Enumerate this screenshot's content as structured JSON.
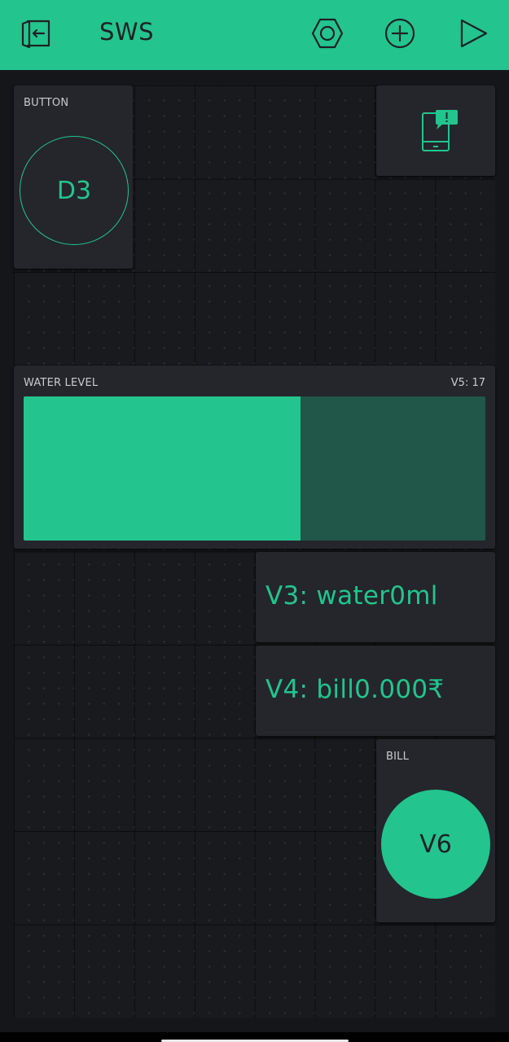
{
  "app": {
    "title": "SWS",
    "accent_color": "#23c48e",
    "background_color": "#15161a",
    "widget_color": "#24262b"
  },
  "toolbar": {
    "icons": [
      "exit-icon",
      "settings-nut-icon",
      "add-icon",
      "play-icon"
    ]
  },
  "widgets": {
    "button": {
      "label": "BUTTON",
      "pin": "D3"
    },
    "notification": {
      "icon": "phone-notification-icon"
    },
    "water_level": {
      "label": "WATER LEVEL",
      "pin_value": "V5: 17",
      "fill_fraction": 0.6
    },
    "v3_display": {
      "text": "V3: water0ml"
    },
    "v4_display": {
      "text": "V4: bill0.000₹"
    },
    "bill": {
      "label": "BILL",
      "pin": "V6"
    }
  }
}
